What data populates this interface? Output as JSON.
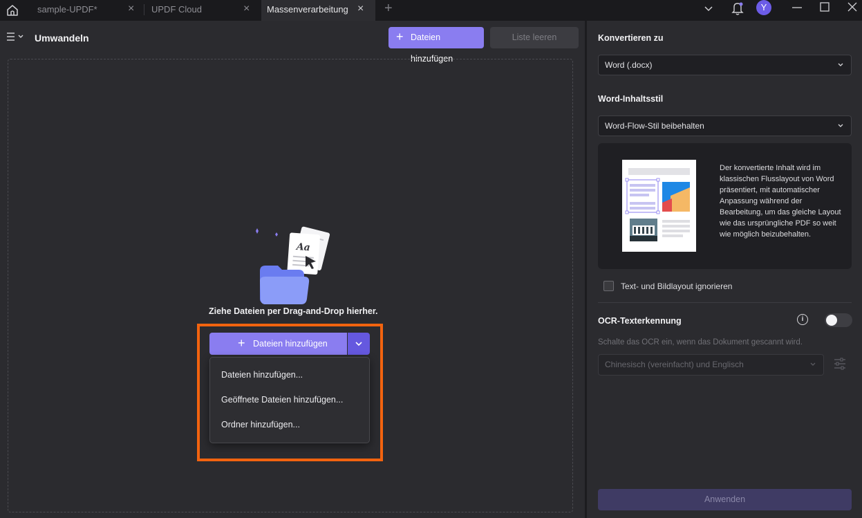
{
  "titlebar": {
    "tabs": [
      {
        "label": "sample-UPDF*",
        "close": "×"
      },
      {
        "label": "UPDF Cloud",
        "close": "×"
      },
      {
        "label": "Massenverarbeitung",
        "close": "×"
      }
    ],
    "new_tab": "+",
    "avatar_letter": "Y",
    "window_controls": [
      "minimize-icon",
      "maximize-icon",
      "close-icon"
    ]
  },
  "header": {
    "title": "Umwandeln",
    "add_files_label": "Dateien hinzufügen",
    "clear_list_label": "Liste leeren"
  },
  "dropzone": {
    "hint": "Ziehe Dateien per Drag-and-Drop hierher.",
    "add_button_label": "Dateien hinzufügen",
    "menu": [
      "Dateien hinzufügen...",
      "Geöffnete Dateien hinzufügen...",
      "Ordner hinzufügen..."
    ]
  },
  "settings": {
    "convert_to_label": "Konvertieren zu",
    "convert_to_value": "Word (.docx)",
    "content_style_label": "Word-Inhaltsstil",
    "content_style_value": "Word-Flow-Stil beibehalten",
    "style_description": "Der konvertierte Inhalt wird im klassischen Flusslayout von Word präsentiert, mit automatischer Anpassung während der Bearbeitung, um das gleiche Layout wie das ursprüngliche PDF so weit wie möglich beizubehalten.",
    "ignore_layout_label": "Text- und Bildlayout ignorieren",
    "ignore_layout_checked": false,
    "ocr_label": "OCR-Texterkennung",
    "ocr_enabled": false,
    "ocr_hint": "Schalte das OCR ein, wenn das Dokument gescannt wird.",
    "ocr_language_value": "Chinesisch (vereinfacht) und Englisch",
    "apply_label": "Anwenden"
  },
  "colors": {
    "accent": "#8a7df0",
    "highlight": "#f2630f",
    "background": "#2b2b2f"
  }
}
